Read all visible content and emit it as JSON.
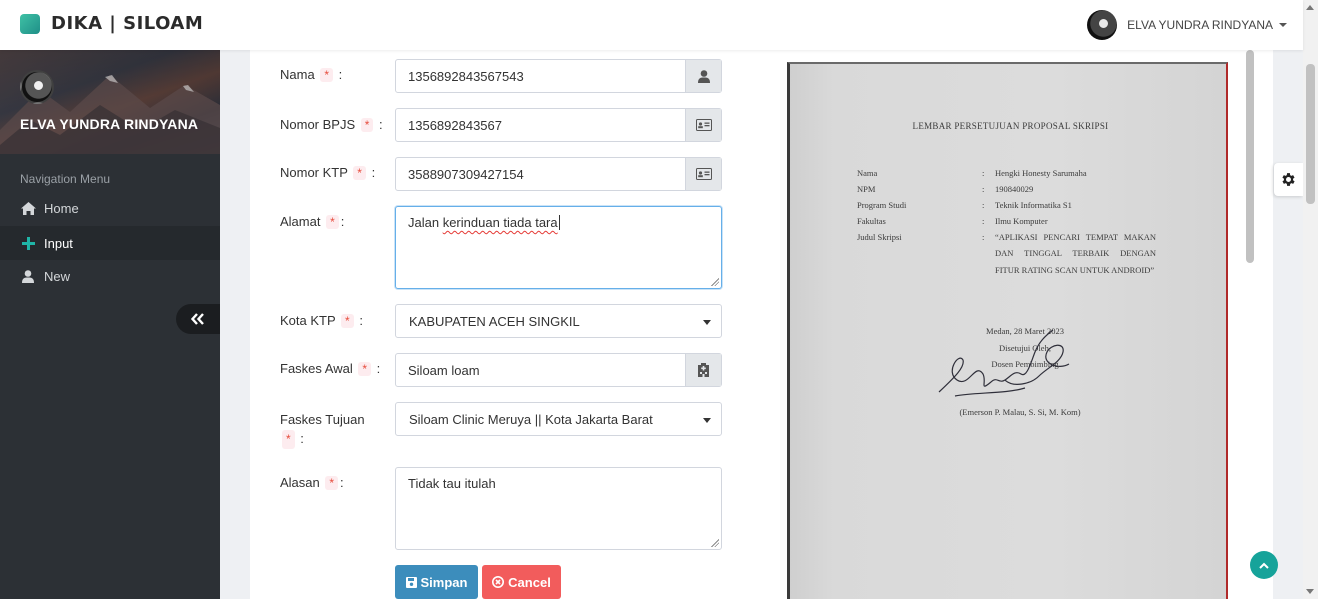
{
  "app": {
    "title": "DIKA | SILOAM"
  },
  "topbar": {
    "user_name": "ELVA YUNDRA RINDYANA"
  },
  "sidebar": {
    "user_name": "ELVA YUNDRA RINDYANA",
    "nav_heading": "Navigation Menu",
    "items": [
      {
        "label": "Home",
        "icon": "home-icon",
        "active": false
      },
      {
        "label": "Input",
        "icon": "plus-icon",
        "active": true
      },
      {
        "label": "New",
        "icon": "user-icon",
        "active": false
      }
    ]
  },
  "form": {
    "required_mark": "*",
    "nama": {
      "label": "Nama",
      "value": "1356892843567543"
    },
    "bpjs": {
      "label": "Nomor BPJS",
      "value": "1356892843567"
    },
    "ktp": {
      "label": "Nomor KTP",
      "value": "3588907309427154"
    },
    "alamat": {
      "label": "Alamat",
      "value_plain": "Jalan ",
      "value_misspelled": "kerinduan tiada tara"
    },
    "kota": {
      "label": "Kota KTP",
      "value": "KABUPATEN ACEH SINGKIL"
    },
    "faskes_awal": {
      "label": "Faskes Awal",
      "value": "Siloam loam"
    },
    "faskes_tujuan": {
      "label_line1": "Faskes Tujuan",
      "value": "Siloam Clinic Meruya || Kota Jakarta Barat"
    },
    "alasan": {
      "label": "Alasan",
      "value": "Tidak tau itulah"
    },
    "save_label": "Simpan",
    "cancel_label": "Cancel"
  },
  "document": {
    "title": "LEMBAR PERSETUJUAN PROPOSAL SKRIPSI",
    "fields": [
      {
        "key": "Nama",
        "value": "Hengki Honesty Sarumaha"
      },
      {
        "key": "NPM",
        "value": "190840029"
      },
      {
        "key": "Program Studi",
        "value": "Teknik Informatika S1"
      },
      {
        "key": "Fakultas",
        "value": "Ilmu Komputer"
      },
      {
        "key": "Judul Skripsi",
        "value": ""
      }
    ],
    "judul": "“APLIKASI PENCARI TEMPAT MAKAN DAN TINGGAL TERBAIK DENGAN FITUR RATING SCAN UNTUK ANDROID”",
    "place_date": "Medan, 28 Maret 2023",
    "approved": "Disetujui Oleh,",
    "supervisor_title": "Dosen Pembimbing",
    "supervisor_name": "(Emerson P. Malau, S. Si, M. Kom)"
  }
}
